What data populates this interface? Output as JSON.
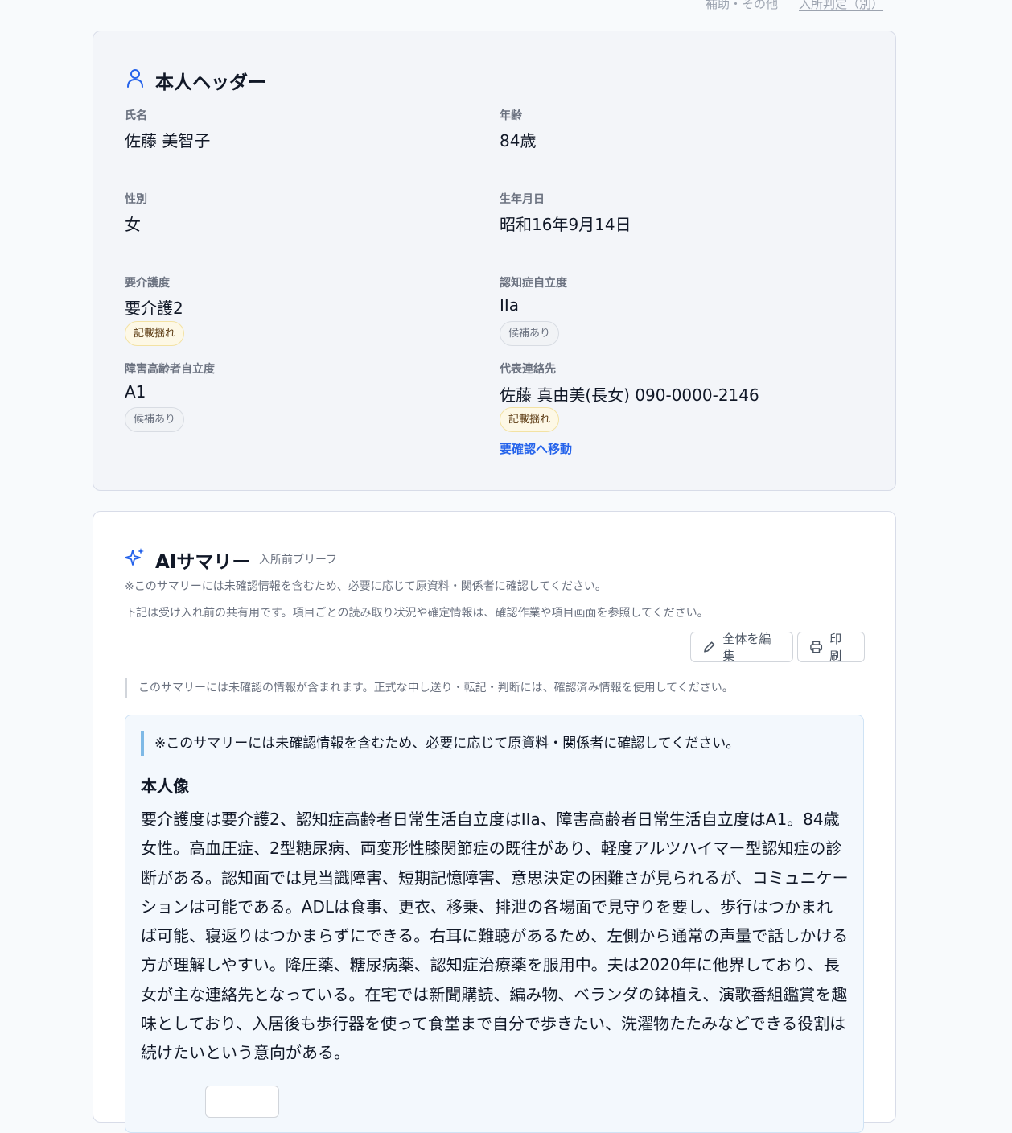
{
  "top_nav": {
    "item_assist": "補助・その他",
    "item_admission": "入所判定（別）"
  },
  "header_card": {
    "title": "本人ヘッダー",
    "icon": "person-icon",
    "fields": {
      "name": {
        "label": "氏名",
        "value": "佐藤 美智子"
      },
      "age": {
        "label": "年齢",
        "value": "84歳"
      },
      "sex": {
        "label": "性別",
        "value": "女"
      },
      "birthdate": {
        "label": "生年月日",
        "value": "昭和16年9月14日"
      },
      "care_level": {
        "label": "要介護度",
        "value": "要介護2",
        "badge": "記載揺れ"
      },
      "dementia": {
        "label": "認知症自立度",
        "value": "IIa",
        "badge": "候補あり"
      },
      "disability": {
        "label": "障害高齢者自立度",
        "value": "A1",
        "badge": "候補あり"
      },
      "contact": {
        "label": "代表連絡先",
        "value": "佐藤 真由美(長女) 090-0000-2146",
        "badge": "記載揺れ",
        "link": "要確認へ移動"
      }
    }
  },
  "summary_card": {
    "title": "AIサマリー",
    "icon": "sparkle-icon",
    "subtitle": "入所前ブリーフ",
    "note1": "※このサマリーには未確認情報を含むため、必要に応じて原資料・関係者に確認してください。",
    "note2": "下記は受け入れ前の共有用です。項目ごとの読み取り状況や確定情報は、確認作業や項目画面を参照してください。",
    "edit_button": "全体を編集",
    "print_button": "印刷",
    "quote": "このサマリーには未確認の情報が含まれます。正式な申し送り・転記・判断には、確認済み情報を使用してください。",
    "box_note": "※このサマリーには未確認情報を含むため、必要に応じて原資料・関係者に確認してください。",
    "section_heading": "本人像",
    "section_body": "要介護度は要介護2、認知症高齢者日常生活自立度はIIa、障害高齢者日常生活自立度はA1。84歳女性。高血圧症、2型糖尿病、両変形性膝関節症の既往があり、軽度アルツハイマー型認知症の診断がある。認知面では見当識障害、短期記憶障害、意思決定の困難さが見られるが、コミュニケーションは可能である。ADLは食事、更衣、移乗、排泄の各場面で見守りを要し、歩行はつかまれば可能、寝返りはつかまらずにできる。右耳に難聴があるため、左側から通常の声量で話しかける方が理解しやすい。降圧薬、糖尿病薬、認知症治療薬を服用中。夫は2020年に他界しており、長女が主な連絡先となっている。在宅では新聞購読、編み物、ベランダの鉢植え、演歌番組鑑賞を趣味としており、入居後も歩行器を使って食堂まで自分で歩きたい、洗濯物たたみなどできる役割は続けたいという意向がある。"
  }
}
